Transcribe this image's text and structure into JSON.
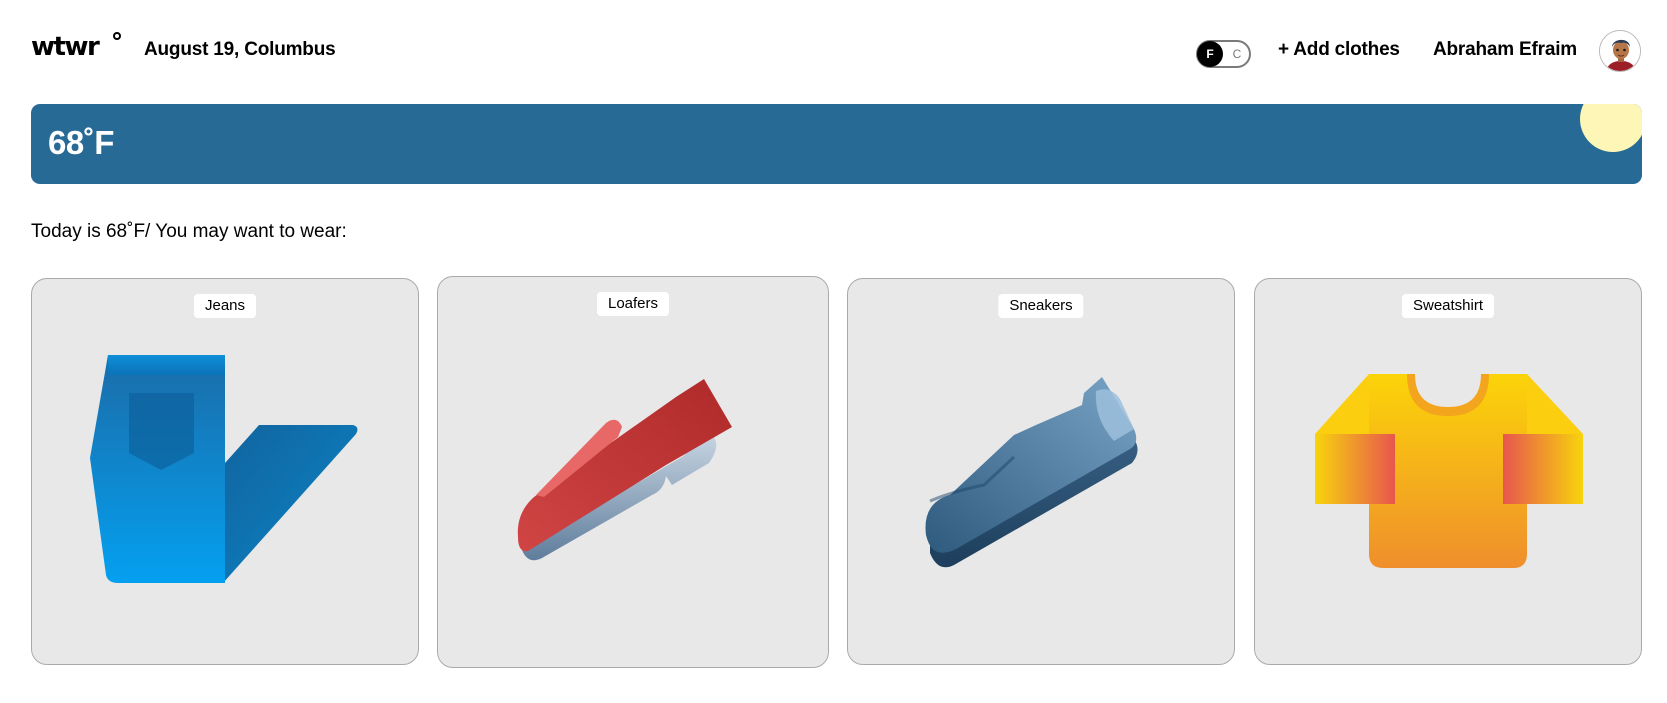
{
  "header": {
    "logo": "wtwr",
    "date_location": "August 19, Columbus",
    "toggle": {
      "on": "F",
      "off": "C",
      "selected": "F"
    },
    "add_clothes": "+ Add clothes",
    "username": "Abraham Efraim"
  },
  "weather": {
    "temperature": "68˚F",
    "condition": "sunny",
    "color": "#286a96"
  },
  "suggestion": "Today is 68˚F/ You may want to wear:",
  "items": [
    {
      "name": "Jeans",
      "icon": "jeans-icon"
    },
    {
      "name": "Loafers",
      "icon": "loafer-icon"
    },
    {
      "name": "Sneakers",
      "icon": "sneaker-icon"
    },
    {
      "name": "Sweatshirt",
      "icon": "sweatshirt-icon"
    }
  ]
}
